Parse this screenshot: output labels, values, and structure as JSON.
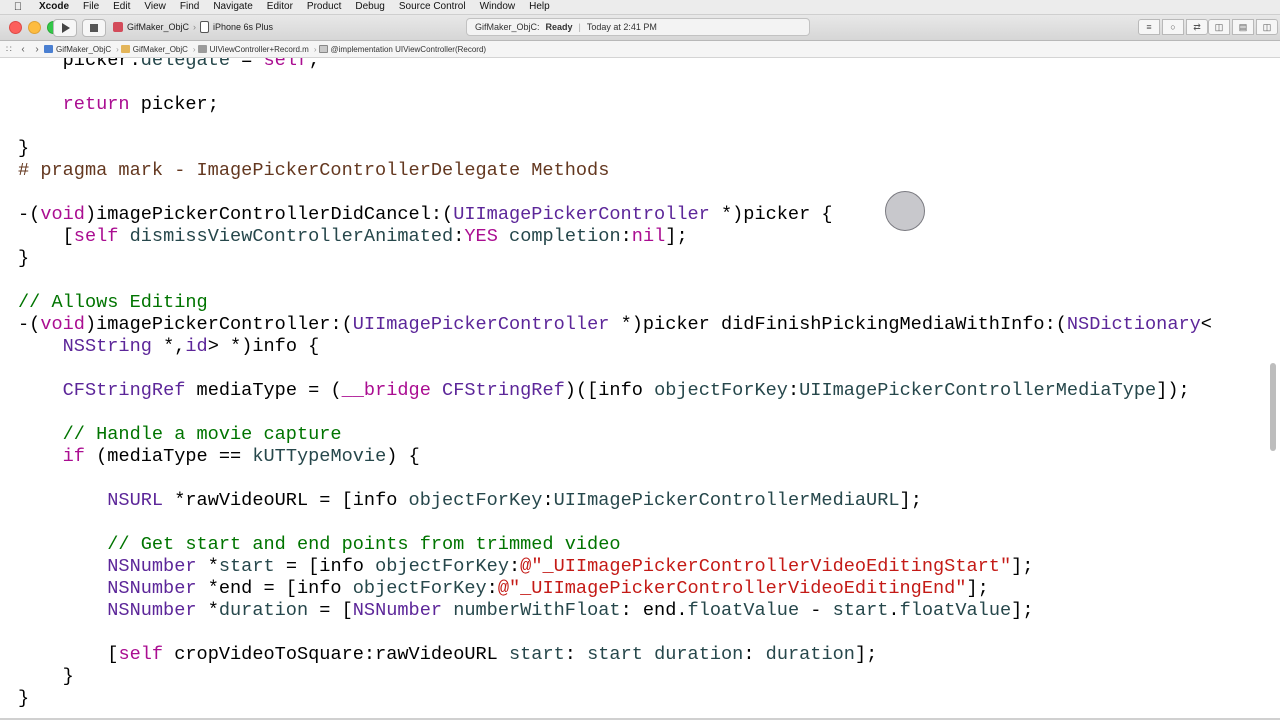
{
  "menubar": {
    "app": "Xcode",
    "items": [
      "File",
      "Edit",
      "View",
      "Find",
      "Navigate",
      "Editor",
      "Product",
      "Debug",
      "Source Control",
      "Window",
      "Help"
    ]
  },
  "toolbar": {
    "scheme_name": "GifMaker_ObjC",
    "device": "iPhone 6s Plus",
    "activity_project": "GifMaker_ObjC:",
    "activity_status": "Ready",
    "activity_time": "Today at 2:41 PM"
  },
  "jumpbar": {
    "crumbs": [
      "GifMaker_ObjC",
      "GifMaker_ObjC",
      "UIViewController+Record.m",
      "@implementation UIViewController(Record)"
    ]
  },
  "code_lines": [
    "    picker.delegate = self;",
    "",
    "    return picker;",
    "",
    "}",
    "# pragma mark - ImagePickerControllerDelegate Methods",
    "",
    "-(void)imagePickerControllerDidCancel:(UIImagePickerController *)picker {",
    "    [self dismissViewControllerAnimated:YES completion:nil];",
    "}",
    "",
    "// Allows Editing",
    "-(void)imagePickerController:(UIImagePickerController *)picker didFinishPickingMediaWithInfo:(NSDictionary<",
    "    NSString *,id> *)info {",
    "",
    "    CFStringRef mediaType = (__bridge CFStringRef)([info objectForKey:UIImagePickerControllerMediaType]);",
    "",
    "    // Handle a movie capture",
    "    if (mediaType == kUTTypeMovie) {",
    "",
    "        NSURL *rawVideoURL = [info objectForKey:UIImagePickerControllerMediaURL];",
    "",
    "        // Get start and end points from trimmed video",
    "        NSNumber *start = [info objectForKey:@\"_UIImagePickerControllerVideoEditingStart\"];",
    "        NSNumber *end = [info objectForKey:@\"_UIImagePickerControllerVideoEditingEnd\"];",
    "        NSNumber *duration = [NSNumber numberWithFloat: end.floatValue - start.floatValue];",
    "",
    "        [self cropVideoToSquare:rawVideoURL start: start duration: duration];",
    "    }",
    "}"
  ]
}
